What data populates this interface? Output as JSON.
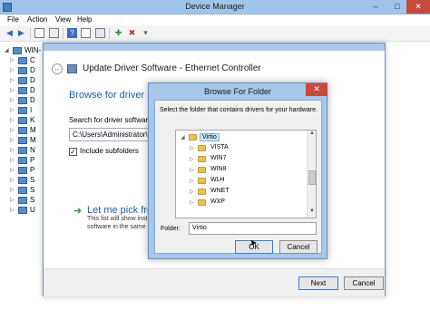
{
  "device_manager": {
    "title": "Device Manager",
    "menu": [
      "File",
      "Action",
      "View",
      "Help"
    ],
    "caption": {
      "minimize": "–",
      "maximize": "□",
      "close": "✕"
    },
    "tree_root": "WIN-",
    "tree_items": [
      "C",
      "D",
      "D",
      "D",
      "D",
      "I",
      "K",
      "M",
      "M",
      "N",
      "P",
      "P",
      "S",
      "S",
      "S",
      "U"
    ]
  },
  "wizard": {
    "title": "Update Driver Software - Ethernet Controller",
    "heading": "Browse for driver sofi",
    "search_label": "Search for driver software in",
    "path_value": "C:\\Users\\Administrator\\Do",
    "include_subfolders": "Include subfolders",
    "pick_title": "Let me pick from",
    "pick_desc_line1": "This list will show inst",
    "pick_desc_line2": "software in the same",
    "next_label": "Next",
    "cancel_label": "Cancel"
  },
  "browse_folder": {
    "title": "Browse For Folder",
    "instruction": "Select the folder that contains drivers for your hardware.",
    "folders": [
      {
        "name": "Virtio",
        "expanded": true,
        "selected": true
      },
      {
        "name": "VISTA"
      },
      {
        "name": "WIN7"
      },
      {
        "name": "WIN8"
      },
      {
        "name": "WLH"
      },
      {
        "name": "WNET"
      },
      {
        "name": "WXP"
      }
    ],
    "folder_label": "Folder:",
    "folder_value": "Virtio",
    "ok_label": "OK",
    "cancel_label": "Cancel"
  }
}
